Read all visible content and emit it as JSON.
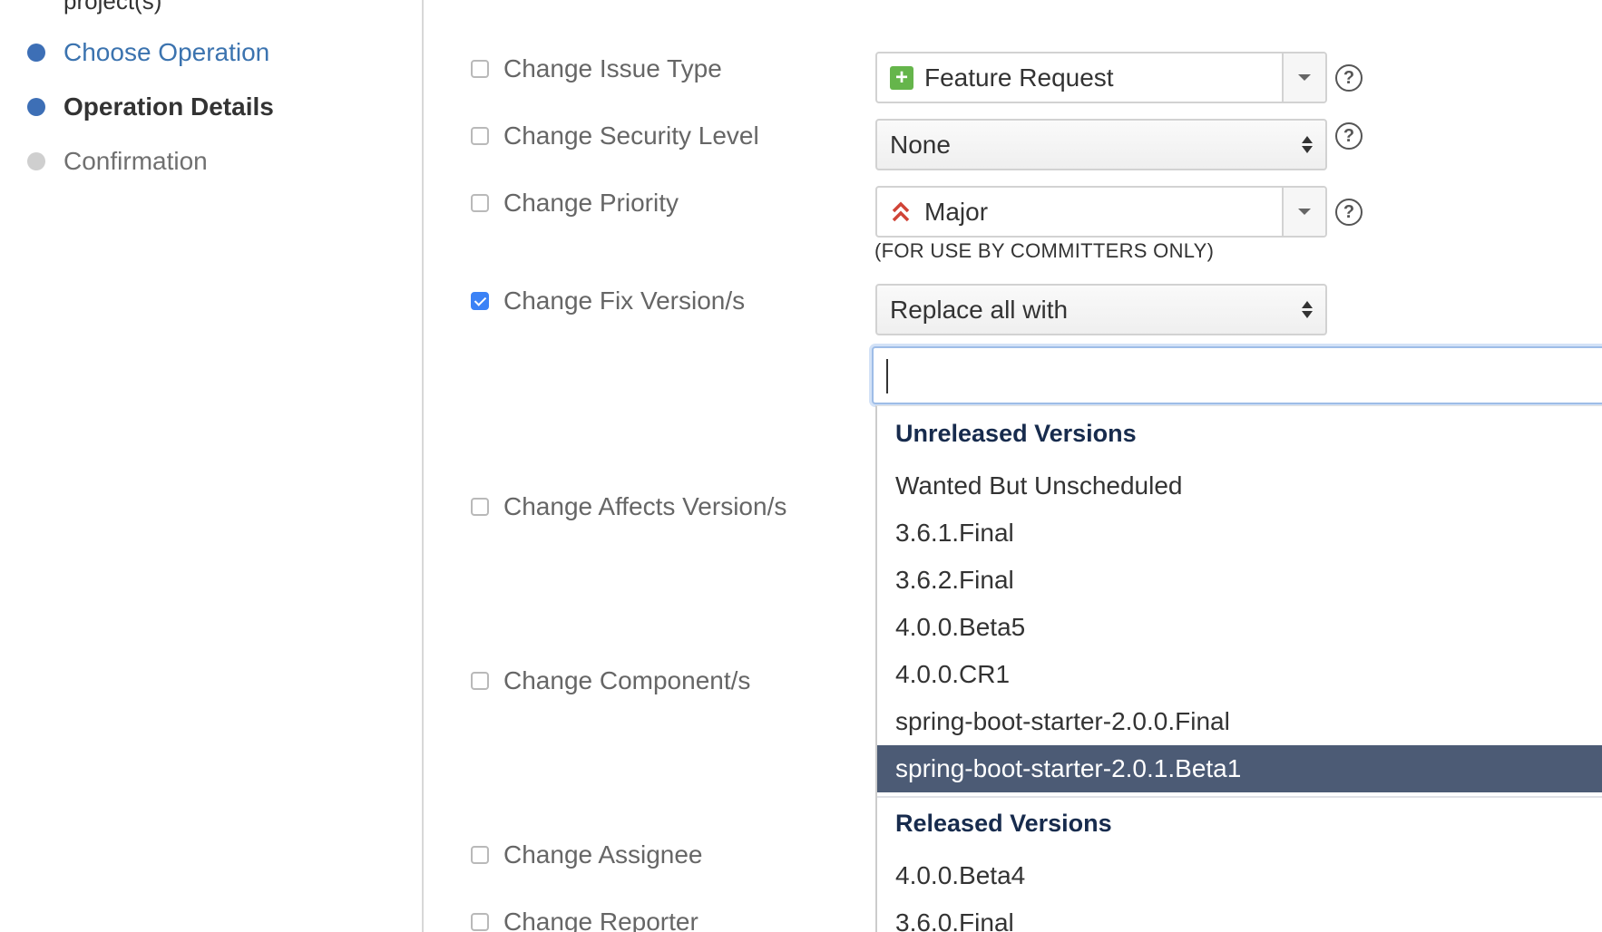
{
  "sidebar": {
    "cut_text": "project(s)",
    "steps": [
      {
        "label": "Choose Operation",
        "state": "link"
      },
      {
        "label": "Operation Details",
        "state": "current"
      },
      {
        "label": "Confirmation",
        "state": "future"
      }
    ]
  },
  "form": {
    "rows": [
      {
        "label": "Change Issue Type",
        "checked": false
      },
      {
        "label": "Change Security Level",
        "checked": false
      },
      {
        "label": "Change Priority",
        "checked": false
      },
      {
        "label": "Change Fix Version/s",
        "checked": true
      },
      {
        "label": "Change Affects Version/s",
        "checked": false
      },
      {
        "label": "Change Component/s",
        "checked": false
      },
      {
        "label": "Change Assignee",
        "checked": false
      },
      {
        "label": "Change Reporter",
        "checked": false
      }
    ],
    "issue_type": {
      "value": "Feature Request",
      "icon": "plus-icon"
    },
    "security_level": {
      "value": "None"
    },
    "priority": {
      "value": "Major",
      "icon": "double-chevron-up-icon",
      "note": "(FOR USE BY COMMITTERS ONLY)"
    },
    "fix_version_mode": {
      "value": "Replace all with"
    },
    "fix_version_input": {
      "value": ""
    },
    "help_glyph": "?"
  },
  "dropdown": {
    "groups": [
      {
        "title": "Unreleased Versions",
        "items": [
          "Wanted But Unscheduled",
          "3.6.1.Final",
          "3.6.2.Final",
          "4.0.0.Beta5",
          "4.0.0.CR1",
          "spring-boot-starter-2.0.0.Final",
          "spring-boot-starter-2.0.1.Beta1"
        ],
        "active_index": 6
      },
      {
        "title": "Released Versions",
        "items": [
          "4.0.0.Beta4",
          "3.6.0.Final"
        ]
      }
    ]
  },
  "colors": {
    "link": "#3b73af",
    "step_dot": "#3d6fb6",
    "checkbox_checked": "#3b82f6",
    "highlight_bg": "#4c5b75",
    "issue_type_green": "#65b54b",
    "priority_red": "#d04437"
  }
}
